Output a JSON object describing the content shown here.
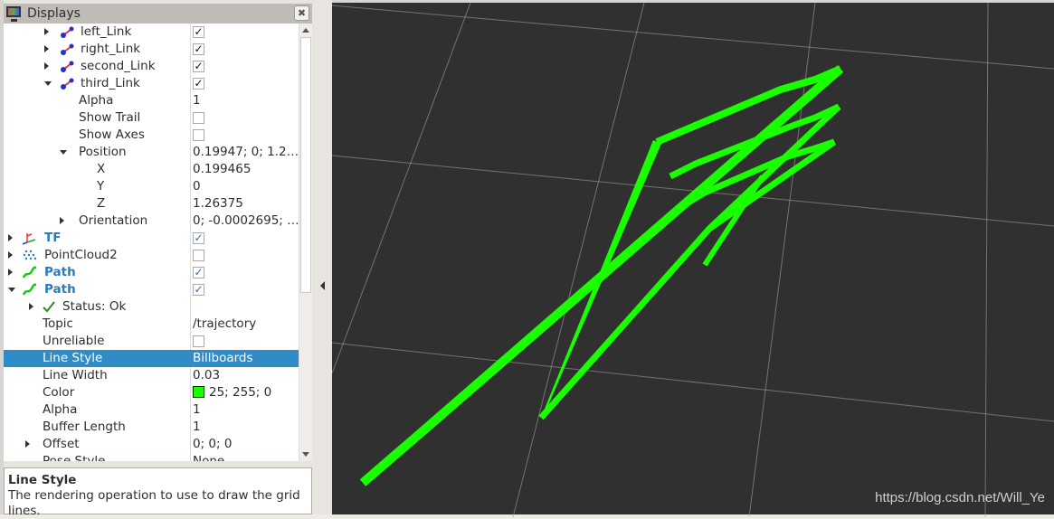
{
  "panel": {
    "title": "Displays",
    "icon": "monitor-icon",
    "close_icon": "close-icon"
  },
  "rows": [
    {
      "label": "left_Link",
      "expand": "collapsed",
      "icon": "link-icon",
      "checked": true
    },
    {
      "label": "right_Link",
      "expand": "collapsed",
      "icon": "link-icon",
      "checked": true
    },
    {
      "label": "second_Link",
      "expand": "collapsed",
      "icon": "link-icon",
      "checked": true
    },
    {
      "label": "third_Link",
      "expand": "expanded",
      "icon": "link-icon",
      "checked": true
    },
    {
      "label": "Alpha",
      "value": "1"
    },
    {
      "label": "Show Trail",
      "checked": false
    },
    {
      "label": "Show Axes",
      "checked": false
    },
    {
      "label": "Position",
      "expand": "expanded",
      "value": "0.19947; 0; 1.2…"
    },
    {
      "label": "X",
      "value": "0.199465"
    },
    {
      "label": "Y",
      "value": "0"
    },
    {
      "label": "Z",
      "value": "1.26375"
    },
    {
      "label": "Orientation",
      "expand": "collapsed",
      "value": "0; -0.0002695; …"
    },
    {
      "label": "TF",
      "expand": "collapsed",
      "icon": "tf-icon",
      "bold": true,
      "checked": true
    },
    {
      "label": "PointCloud2",
      "expand": "collapsed",
      "icon": "pointcloud-icon",
      "checked": false
    },
    {
      "label": "Path",
      "expand": "collapsed",
      "icon": "path-icon",
      "bold": true,
      "checked": true
    },
    {
      "label": "Path",
      "expand": "expanded",
      "icon": "path-icon",
      "bold": true,
      "checked": true
    },
    {
      "label": "Status: Ok",
      "expand": "collapsed",
      "icon": "status-ok-icon"
    },
    {
      "label": "Topic",
      "value": "/trajectory"
    },
    {
      "label": "Unreliable",
      "checked": false
    },
    {
      "label": "Line Style",
      "value": "Billboards",
      "selected": true
    },
    {
      "label": "Line Width",
      "value": "0.03"
    },
    {
      "label": "Color",
      "value": "25; 255; 0",
      "swatch": "#19ff00"
    },
    {
      "label": "Alpha",
      "value": "1"
    },
    {
      "label": "Buffer Length",
      "value": "1"
    },
    {
      "label": "Offset",
      "expand": "collapsed",
      "value": "0; 0; 0"
    },
    {
      "label": "Pose Style",
      "value": "None"
    }
  ],
  "description": {
    "title": "Line Style",
    "text": "The rendering operation to use to draw the grid lines."
  },
  "viewport": {
    "background": "#303030",
    "path_color": "#19ff00",
    "grid_color": "#a0a0a0",
    "watermark": "https://blog.csdn.net/Will_Ye"
  }
}
